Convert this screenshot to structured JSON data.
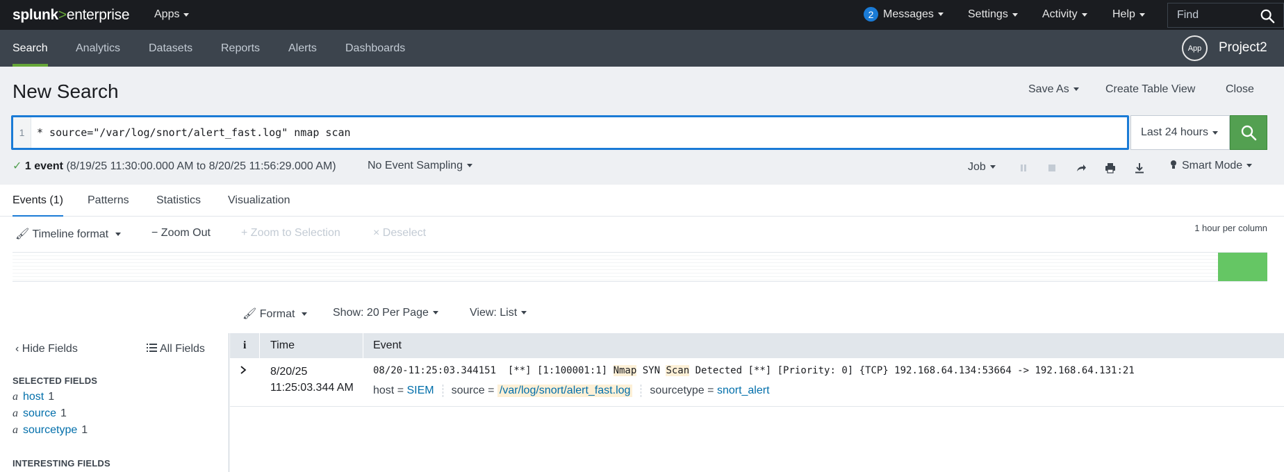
{
  "topbar": {
    "logo_part1": "splunk",
    "logo_part2": ">",
    "logo_part3": "enterprise",
    "apps_label": "Apps",
    "messages_count": "2",
    "messages_label": "Messages",
    "settings_label": "Settings",
    "activity_label": "Activity",
    "help_label": "Help",
    "find_placeholder": "Find"
  },
  "appbar": {
    "tabs": [
      "Search",
      "Analytics",
      "Datasets",
      "Reports",
      "Alerts",
      "Dashboards"
    ],
    "active_tab": "Search",
    "app_logo_text": "App",
    "app_name": "Project2"
  },
  "search": {
    "title": "New Search",
    "save_as": "Save As",
    "create_table_view": "Create Table View",
    "close": "Close",
    "line_number": "1",
    "query": "* source=\"/var/log/snort/alert_fast.log\" nmap scan",
    "time_range": "Last 24 hours",
    "status_count": "1 event",
    "status_range": "(8/19/25 11:30:00.000 AM to 8/20/25 11:56:29.000 AM)",
    "sampling": "No Event Sampling",
    "job": "Job",
    "mode": "Smart Mode"
  },
  "tabs": [
    "Events (1)",
    "Patterns",
    "Statistics",
    "Visualization"
  ],
  "timeline": {
    "format": "Timeline format",
    "zoom_out": "Zoom Out",
    "zoom_selection": "Zoom to Selection",
    "deselect": "Deselect",
    "per_column": "1 hour per column"
  },
  "results_toolbar": {
    "format": "Format",
    "show": "Show: 20 Per Page",
    "view": "View: List"
  },
  "sidebar": {
    "hide_fields": "Hide Fields",
    "all_fields": "All Fields",
    "selected_heading": "SELECTED FIELDS",
    "selected_fields": [
      {
        "type": "a",
        "name": "host",
        "count": "1"
      },
      {
        "type": "a",
        "name": "source",
        "count": "1"
      },
      {
        "type": "a",
        "name": "sourcetype",
        "count": "1"
      }
    ],
    "interesting_heading": "INTERESTING FIELDS"
  },
  "events_table": {
    "col_info": "i",
    "col_time": "Time",
    "col_event": "Event",
    "event": {
      "date": "8/20/25",
      "time": "11:25:03.344 AM",
      "raw_pre": "08/20-11:25:03.344151  [**] [1:100001:1] ",
      "raw_hl1": "Nmap",
      "raw_mid": " SYN ",
      "raw_hl2": "Scan",
      "raw_post": " Detected [**] [Priority: 0] {TCP} 192.168.64.134:53664 -> 192.168.64.131:21",
      "host_key": "host =",
      "host_val": "SIEM",
      "source_key": "source =",
      "source_val": "/var/log/snort/alert_fast.log",
      "sourcetype_key": "sourcetype =",
      "sourcetype_val": "snort_alert"
    }
  },
  "colors": {
    "topbar_bg": "#1a1c20",
    "appbar_bg": "#3c444d",
    "accent_green": "#65a637",
    "search_button": "#53a051",
    "focus_blue": "#1a7bd6",
    "link_blue": "#006eaa",
    "timeline_bar": "#65c664"
  }
}
